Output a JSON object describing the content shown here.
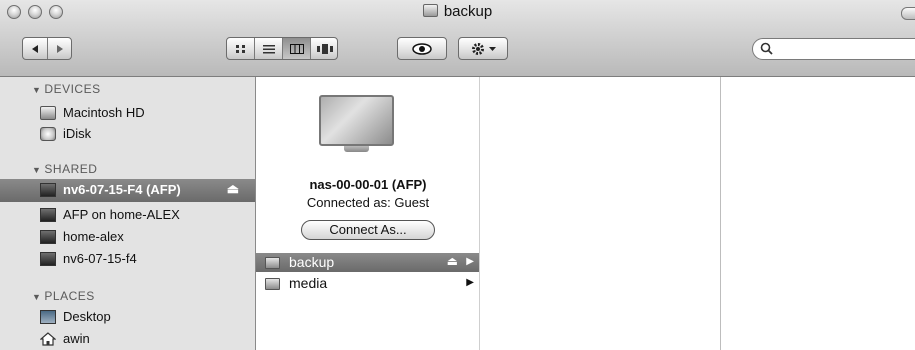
{
  "window": {
    "title": "backup"
  },
  "toolbar": {
    "search": {
      "placeholder": ""
    }
  },
  "sidebar": {
    "sections": [
      {
        "label": "DEVICES"
      },
      {
        "label": "SHARED"
      },
      {
        "label": "PLACES"
      }
    ],
    "devices": [
      {
        "label": "Macintosh HD",
        "icon": "hard-disk-icon"
      },
      {
        "label": "iDisk",
        "icon": "idisk-icon"
      }
    ],
    "shared": [
      {
        "label": "nv6-07-15-F4 (AFP)",
        "icon": "monitor-icon",
        "selected": true,
        "eject": "⏏"
      },
      {
        "label": "AFP on home-ALEX",
        "icon": "monitor-icon"
      },
      {
        "label": "home-alex",
        "icon": "monitor-icon"
      },
      {
        "label": "nv6-07-15-f4",
        "icon": "monitor-icon"
      }
    ],
    "places": [
      {
        "label": "Desktop",
        "icon": "desktop-icon"
      },
      {
        "label": "awin",
        "icon": "home-icon"
      }
    ]
  },
  "server_panel": {
    "name": "nas-00-00-01 (AFP)",
    "status": "Connected as: Guest",
    "connect_button": "Connect As..."
  },
  "volumes": [
    {
      "label": "backup",
      "selected": true,
      "eject": "⏏",
      "arrow": "▶"
    },
    {
      "label": "media",
      "selected": false,
      "arrow": "▶"
    }
  ]
}
